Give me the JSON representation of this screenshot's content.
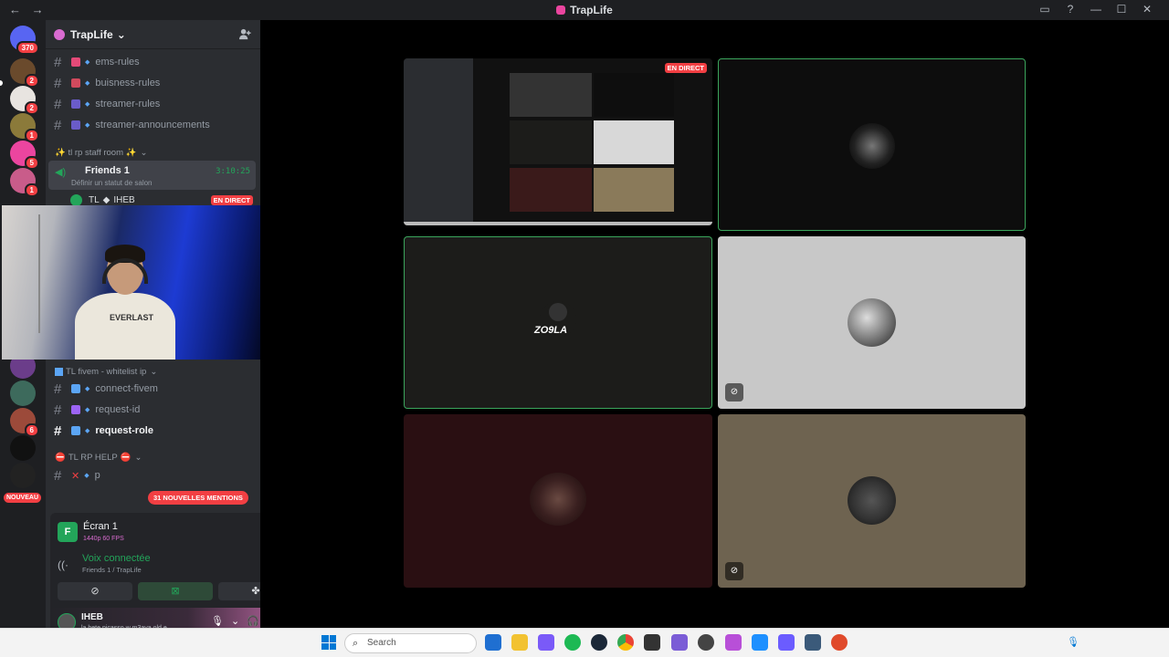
{
  "window": {
    "title": "TrapLife",
    "nav_back": "←",
    "nav_forward": "→",
    "controls": [
      "▭",
      "?",
      "—",
      "☐",
      "✕"
    ]
  },
  "guild_badges": [
    "370",
    "2",
    "2",
    "1",
    "5",
    "1",
    "6"
  ],
  "nouveau_label": "NOUVEAU",
  "server": {
    "name": "TrapLife",
    "chevron": "⌄",
    "add_member_icon": "add-member-icon"
  },
  "channels": {
    "top": [
      {
        "name": "ems-rules",
        "emoji_color": "#e44a78"
      },
      {
        "name": "buisness-rules",
        "emoji_color": "#d14a5d"
      },
      {
        "name": "streamer-rules",
        "emoji_color": "#6a5cc9"
      },
      {
        "name": "streamer-announcements",
        "emoji_color": "#6a5cc9"
      }
    ],
    "staff_category": "✨ tl rp staff room ✨",
    "voice": {
      "name": "Friends 1",
      "status": "Définir un statut de salon",
      "time": "3:10:25",
      "member_prefix": "TL",
      "member_name": "IHEB",
      "live_badge": "EN DIRECT"
    },
    "fivem_category": "TL fivem - whitelist ip",
    "fivem": [
      {
        "name": "connect-fivem",
        "bold": false,
        "emoji_color": "#5ba5f5"
      },
      {
        "name": "request-id",
        "bold": false,
        "emoji_color": "#9c64f5"
      },
      {
        "name": "request-role",
        "bold": true,
        "emoji_color": "#5ba5f5"
      }
    ],
    "help_category": "TL RP HELP",
    "help_partial": "p",
    "mentions_badge": "31 NOUVELLES MENTIONS"
  },
  "webcam": {
    "shirt_text": "EVERLAST"
  },
  "panel": {
    "screen_title": "Écran 1",
    "screen_quality": "1440p 60 FPS",
    "screen_icon": "F",
    "voice_status": "Voix connectée",
    "voice_channel": "Friends 1 / TrapLife",
    "user_name": "IHEB",
    "user_status": "la bete picasso w m3aya old e..."
  },
  "stage": {
    "live_badge": "EN DIRECT",
    "tile_colors": [
      "#0d0d0d",
      "#161616",
      "#1c1c1a",
      "#c8c8c8",
      "#2a0f12",
      "#6e6350"
    ],
    "zo9la_text": "ZO9LA"
  },
  "taskbar": {
    "search_placeholder": "Search",
    "search_icon": "⌕",
    "app_colors": [
      "#1f6fd1",
      "#f2c231",
      "#7a5af8",
      "#1db954",
      "#1b2838",
      "#ea4335",
      "#333333",
      "#7b5cd6",
      "#444444",
      "#b84fd8",
      "#1e90ff",
      "#6b5cff",
      "#3b5a7a",
      "#e04a2b"
    ]
  }
}
